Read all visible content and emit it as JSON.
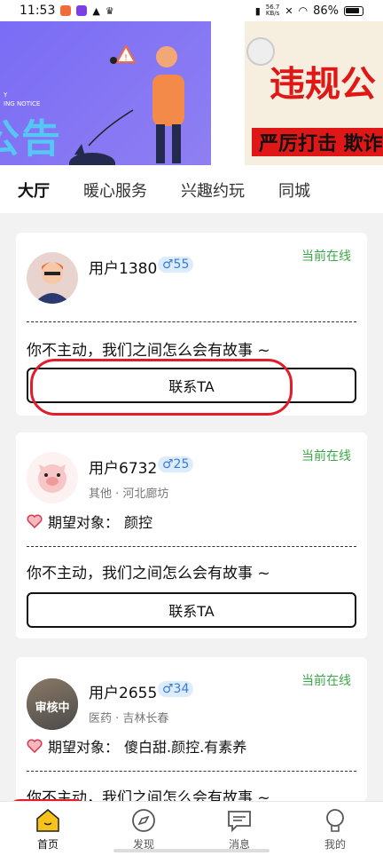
{
  "status_bar": {
    "time": "11:53",
    "net_speed_top": "56.7",
    "net_speed_bottom": "KB/s",
    "battery": "86%"
  },
  "banner": {
    "left_small_text": "Y\nING NOTICE",
    "left_big_text": "公告",
    "right_title": "违规公",
    "right_sub": "严厉打击 欺诈"
  },
  "tabs": [
    "大厅",
    "暖心服务",
    "兴趣约玩",
    "同城"
  ],
  "cards": [
    {
      "username": "用户1380",
      "gender_age": "♂55",
      "online": "当前在线",
      "message": "你不主动，我们之间怎么会有故事 ~",
      "contact": "联系TA"
    },
    {
      "username": "用户6732",
      "gender_age": "♂25",
      "online": "当前在线",
      "meta": "其他 · 河北廊坊",
      "expect_label": "期望对象：",
      "expect_value": "颜控",
      "message": "你不主动，我们之间怎么会有故事 ~",
      "contact": "联系TA"
    },
    {
      "username": "用户2655",
      "gender_age": "♂34",
      "online": "当前在线",
      "meta": "医药 · 吉林长春",
      "review_badge": "审核中",
      "expect_label": "期望对象：",
      "expect_value": "傻白甜.颜控.有素养",
      "message": "你不主动，我们之间怎么会有故事 ~"
    }
  ],
  "bottom_nav": [
    {
      "label": "首页",
      "icon": "home-icon"
    },
    {
      "label": "发现",
      "icon": "compass-icon"
    },
    {
      "label": "消息",
      "icon": "message-icon"
    },
    {
      "label": "我的",
      "icon": "profile-icon"
    }
  ],
  "colors": {
    "accent_yellow": "#f7d22a",
    "online_green": "#3aa84a",
    "annotation_red": "#e11d2a"
  }
}
